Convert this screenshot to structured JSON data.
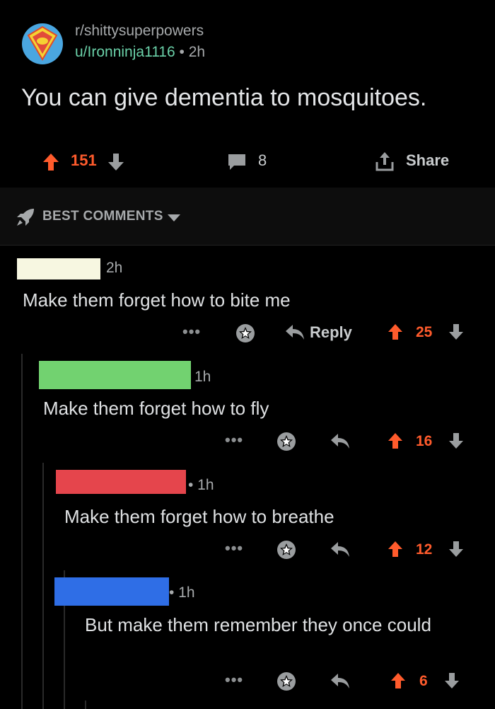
{
  "post": {
    "subreddit": "r/shittysuperpowers",
    "username": "u/Ironninja1116",
    "separator": "•",
    "age": "2h",
    "title": "You can give dementia to mosquitoes.",
    "score": "151",
    "comment_count": "8",
    "share_label": "Share"
  },
  "sort": {
    "label": "BEST COMMENTS"
  },
  "comments": [
    {
      "redaction_color": "#f7f7e1",
      "age": "2h",
      "body": "Make them forget how to bite me",
      "more": "•••",
      "reply_label": "Reply",
      "score": "25"
    },
    {
      "redaction_color": "#72d270",
      "age": "1h",
      "body": "Make them forget how to fly",
      "more": "•••",
      "score": "16"
    },
    {
      "redaction_color": "#e5454c",
      "age": "• 1h",
      "body": "Make them forget how to breathe",
      "more": "•••",
      "score": "12"
    },
    {
      "redaction_color": "#2f6ee6",
      "age": "• 1h",
      "body": "But make them remember they once could",
      "more": "•••",
      "score": "6"
    }
  ],
  "colors": {
    "upvote_orange": "#ff5b2c",
    "muted_text": "#a6a9ab",
    "username_green": "#6ad0a8"
  }
}
